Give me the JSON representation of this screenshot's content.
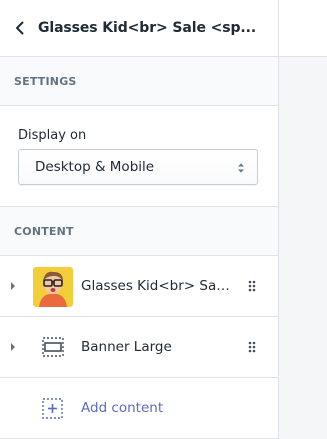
{
  "header": {
    "title": "Glasses Kid<br> Sale <sp...",
    "back_icon": "chevron-left-icon"
  },
  "settings": {
    "heading": "SETTINGS",
    "display_label": "Display on",
    "display_value": "Desktop & Mobile",
    "select_icon": "select-arrows-icon"
  },
  "content": {
    "heading": "CONTENT",
    "items": [
      {
        "label": "Glasses Kid<br> Sale ...",
        "icon": "image-thumbnail",
        "drag_icon": "drag-handle-icon"
      },
      {
        "label": "Banner Large",
        "icon": "banner-icon",
        "drag_icon": "drag-handle-icon"
      }
    ],
    "add_label": "Add content",
    "add_icon": "add-section-icon"
  },
  "colors": {
    "accent": "#5c6ac4",
    "border": "#dfe3e8",
    "muted": "#637381",
    "text": "#212b36"
  }
}
